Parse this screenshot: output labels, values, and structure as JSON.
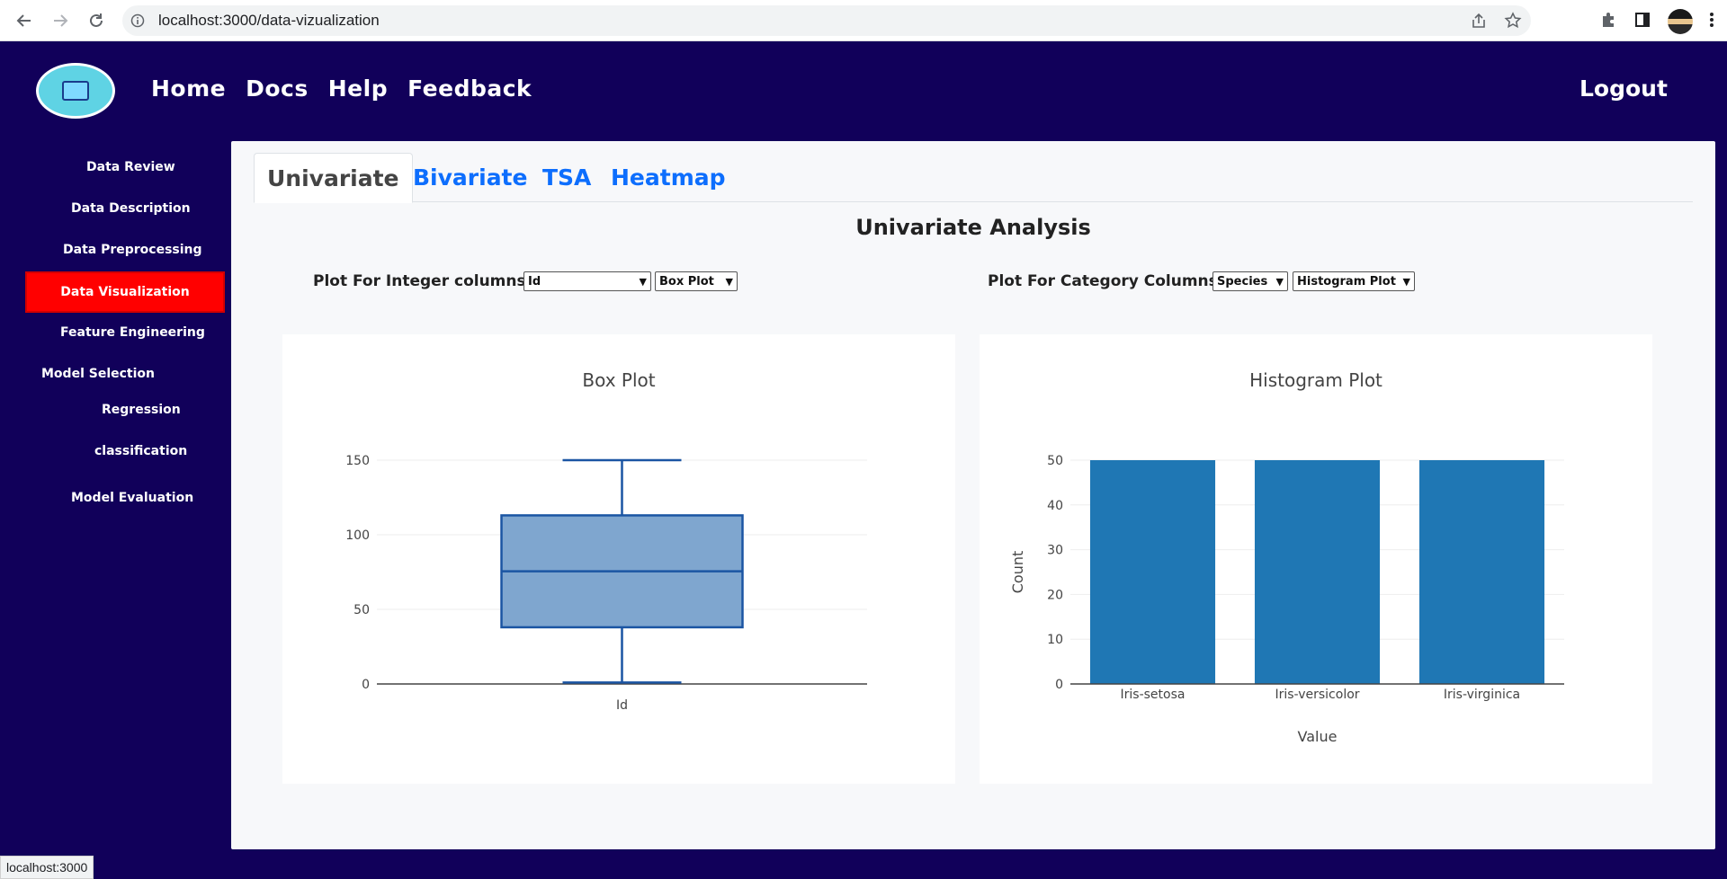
{
  "browser": {
    "url": "localhost:3000/data-vizualization",
    "status_url": "localhost:3000"
  },
  "navbar": {
    "links": [
      "Home",
      "Docs",
      "Help",
      "Feedback"
    ],
    "logout": "Logout"
  },
  "sidebar": {
    "data_review": "Data Review",
    "data_description": "Data Description",
    "data_preprocessing": "Data Preprocessing",
    "data_visualization": "Data Visualization",
    "feature_engineering": "Feature Engineering",
    "model_selection": "Model Selection",
    "regression": "Regression",
    "classification": "classification",
    "model_evaluation": "Model Evaluation"
  },
  "tabs": [
    "Univariate",
    "Bivariate",
    "TSA",
    "Heatmap"
  ],
  "active_tab": "Univariate",
  "section_title": "Univariate Analysis",
  "controls": {
    "integer_label": "Plot For Integer columns:-",
    "integer_column": "Id",
    "integer_plot": "Box Plot",
    "category_label": "Plot For Category Columns:-",
    "category_column": "Species",
    "category_plot": "Histogram Plot"
  },
  "colors": {
    "background": "#11005a",
    "active_sidebar": "#ff0000",
    "tab_link": "#0d6efd",
    "plot_blue": "#1f77b4"
  },
  "chart_data": [
    {
      "type": "box",
      "title": "Box Plot",
      "categories": [
        "Id"
      ],
      "yticks": [
        0,
        50,
        100,
        150
      ],
      "ylim": [
        0,
        150
      ],
      "box": {
        "min": 1,
        "q1": 38,
        "median": 75.5,
        "q3": 113,
        "max": 150
      }
    },
    {
      "type": "bar",
      "title": "Histogram Plot",
      "xlabel": "Value",
      "ylabel": "Count",
      "categories": [
        "Iris-setosa",
        "Iris-versicolor",
        "Iris-virginica"
      ],
      "values": [
        50,
        50,
        50
      ],
      "yticks": [
        0,
        10,
        20,
        30,
        40,
        50
      ],
      "ylim": [
        0,
        50
      ]
    }
  ]
}
